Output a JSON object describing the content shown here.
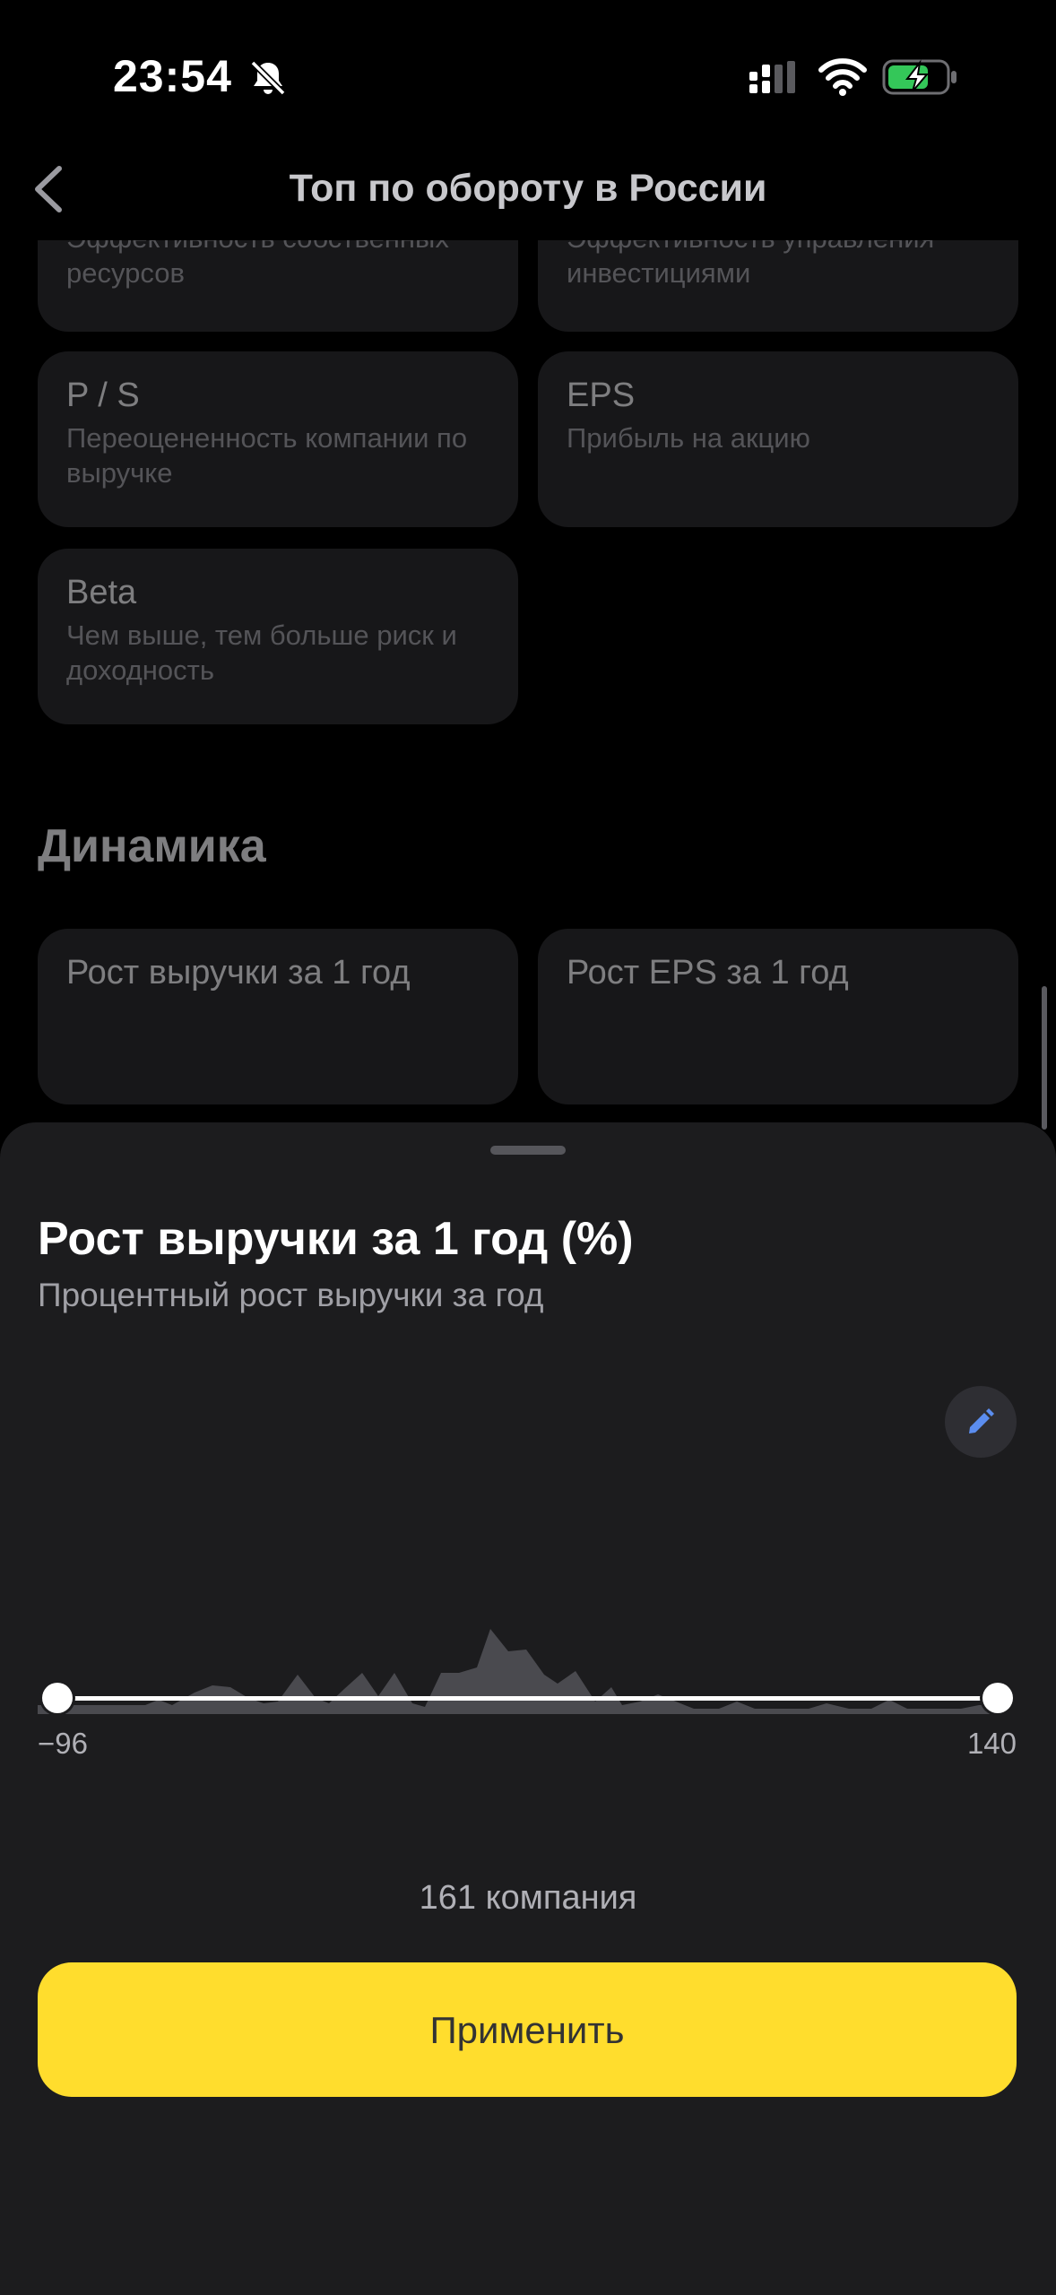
{
  "status_bar": {
    "time": "23:54",
    "icons": [
      "bell-slash-icon",
      "cellular-signal-icon",
      "wifi-icon",
      "battery-charging-icon"
    ]
  },
  "nav": {
    "back_icon": "chevron-left-icon",
    "title": "Топ по обороту в России"
  },
  "metrics": [
    {
      "title": "",
      "desc": "Эффективность собственных ресурсов"
    },
    {
      "title": "",
      "desc": "Эффективность управления инвестициями"
    },
    {
      "title": "P / S",
      "desc": "Переоцененность компании по выручке"
    },
    {
      "title": "EPS",
      "desc": "Прибыль на акцию"
    },
    {
      "title": "Beta",
      "desc": "Чем выше, тем больше риск и доходность"
    }
  ],
  "dynamics": {
    "section_title": "Динамика",
    "cards": [
      {
        "title": "Рост выручки за 1 год"
      },
      {
        "title": "Рост EPS за 1 год"
      }
    ]
  },
  "sheet": {
    "title": "Рост выручки за 1 год (%)",
    "subtitle": "Процентный рост выручки за год",
    "edit_icon": "pencil-icon",
    "range_min": "−96",
    "range_max": "140",
    "slider_min_value": -96,
    "slider_max_value": 140,
    "companies_count": "161 компания",
    "apply_label": "Применить"
  },
  "colors": {
    "accent": "#ffdd2d",
    "sheet_bg": "#1c1c1e",
    "card_bg": "#2a2a2e"
  }
}
